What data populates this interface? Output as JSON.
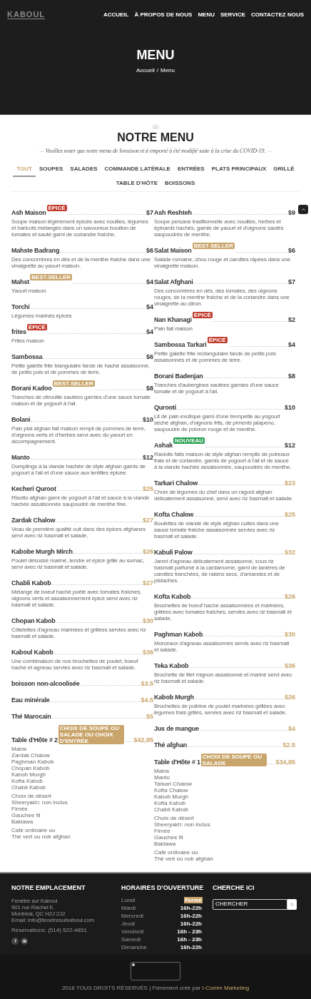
{
  "header": {
    "logo": "KABOUL",
    "nav": [
      {
        "label": "ACCUEIL",
        "selected": false
      },
      {
        "label": "À PROPOS DE NOUS",
        "selected": false
      },
      {
        "label": "MENU",
        "selected": false
      },
      {
        "label": "SERVICE",
        "selected": false
      },
      {
        "label": "CONTACTEZ NOUS",
        "selected": false
      }
    ],
    "title": "MENU",
    "breadcrumb": [
      "Accueil",
      "/",
      "Menu"
    ]
  },
  "menu": {
    "title": "NOTRE MENU",
    "notice": "Veuillez noter que notre menu de livraison et à emporté à été modifié suite à la crise du COVID-19.",
    "tabs": [
      {
        "label": "TOUT",
        "selected": true
      },
      {
        "label": "SOUPES",
        "selected": false
      },
      {
        "label": "SALADES",
        "selected": false
      },
      {
        "label": "COMMANDE LATÉRALE",
        "selected": false
      },
      {
        "label": "ENTRÉES",
        "selected": false
      },
      {
        "label": "PLATS PRINCIPAUX",
        "selected": false
      },
      {
        "label": "GRILLÉ",
        "selected": false
      },
      {
        "label": "TABLE D'HÔTE",
        "selected": false
      },
      {
        "label": "BOISSONS",
        "selected": false
      }
    ],
    "columns": [
      [
        {
          "name": "Ash Maison",
          "badge": {
            "kind": "spicy",
            "label": "ÉPICÉ"
          },
          "price": "$7",
          "color": "#333333",
          "description": "Soupe maison légèrement épicée avec nouilles, légumes et haricots mélangés dans un savoureux bouillon de tomates et sauté garni de coriandre fraîche."
        },
        {
          "name": "Mahste Badrang",
          "price": "$6",
          "color": "#333333",
          "description": "Des concombres en dés et de la menthe fraîche dans une vinaigrette au yaourt maison."
        },
        {
          "name": "Mahst",
          "badge": {
            "kind": "bestseller",
            "label": "BEST-SELLER"
          },
          "price": "$4",
          "color": "#333333",
          "description": "Yaourt maison"
        },
        {
          "name": "Torchi",
          "price": "$4",
          "color": "#333333",
          "description": "Légumes marinés épicés"
        },
        {
          "name": "frites",
          "badge": {
            "kind": "spicy",
            "label": "ÉPICÉ"
          },
          "price": "$4",
          "color": "#333333",
          "description": "Frites maison"
        },
        {
          "name": "Sambossa",
          "price": "$6",
          "color": "#333333",
          "description": "Petite galette frite triangulaire farcie de haché assaisonné, de petits pois et de pommes de terre."
        },
        {
          "name": "Borani Kadoo",
          "badge": {
            "kind": "bestseller",
            "label": "BEST-SELLER"
          },
          "price": "$8",
          "color": "#333333",
          "description": "Tranches de citrouille sautées garnies d'une sauce tomate maison et de yogourt à l'ail."
        },
        {
          "name": "Bolani",
          "price": "$10",
          "color": "#333333",
          "description": "Pain plat afghan fait maison rempli de pommes de terre, d'oignons verts et d'herbes servi avec du yaourt en accompagnement."
        },
        {
          "name": "Manto",
          "price": "$12",
          "color": "#333333",
          "description": "Dumplings à la viande hachée de style afghan garnis de yogourt à l'ail et d'une sauce aux lentilles épicée."
        },
        {
          "name": "Kecheri Quroot",
          "price": "$25",
          "color": "#c9a56b",
          "description": "Risotto afghan garni de yogourt à l'ail et sauce à la viande hachée assaisonnée saupoudré de menthe fine."
        },
        {
          "name": "Zardak Chalow",
          "price": "$27",
          "color": "#c9a56b",
          "description": "Veau de première qualité cuit dans des épices afghanes servi avec riz basmati et salade."
        },
        {
          "name": "Kabobe Murgh Mirch",
          "price": "$26",
          "color": "#c9a56b",
          "description": "Poulet désossé mariné, tendre et épicé grillé au sumac, servi avec riz basmati et salade."
        },
        {
          "name": "Chabli Kabob",
          "price": "$27",
          "color": "#c9a56b",
          "description": "Mélange de boeuf haché poêlé avec tomates fraîches, oignons verts et assaisonnement épicé servi avec riz basmati et salade."
        },
        {
          "name": "Chopan Kabob",
          "price": "$30",
          "color": "#c9a56b",
          "description": "Côtelettes d'agneau marinées et grillées servies avec riz basmati et salade."
        },
        {
          "name": "Kaboul Kabob",
          "price": "$36",
          "color": "#c9a56b",
          "description": "Une combinaison de nos brochettes de poulet, boeuf haché et agneau servies avec riz basmati et salade."
        },
        {
          "name": "boisson non-alcoolisée",
          "price": "$3.5",
          "color": "#c9a56b"
        },
        {
          "name": "Eau minérale",
          "price": "$4.5",
          "color": "#c9a56b"
        },
        {
          "name": "Thé Marocain",
          "price": "$5",
          "color": "#c9a56b"
        },
        {
          "name": "Table d'Hôte # 2",
          "badge": {
            "kind": "info",
            "label": "CHOIX DE SOUPE OU SALADE OU CHOIX D'ENTRÉE"
          },
          "price": "$42,95",
          "color": "#c9a56b",
          "courses": [
            [
              "Mains",
              "Zardak Chalow",
              "Paghman Kabob",
              "Chopan Kabob",
              "Kabob Murgh",
              "Kofta Kabob",
              "Chabli Kabob"
            ],
            [
              "Choix de désert",
              "Sheeryakh: non inclus",
              "Firnée",
              "Gauchee fil",
              "Baklawa"
            ],
            [
              "Café ordinaire ou",
              "Thé vert ou noir afghan"
            ]
          ]
        }
      ],
      [
        {
          "name": "Ash Reshteh",
          "price": "$9",
          "color": "#333333",
          "description": "Soupe persane traditionnelle avec nouilles, herbes et épinards hachés, garnie de yaourt et d'oignons sautés saupoudrés de menthe."
        },
        {
          "name": "Salat Maison",
          "badge": {
            "kind": "bestseller",
            "label": "BEST-SELLER"
          },
          "price": "$6",
          "color": "#333333",
          "description": "Salade romaine, chou rouge et carottes râpées dans une vinaigrette maison."
        },
        {
          "name": "Salat Afghani",
          "price": "$7",
          "color": "#333333",
          "description": "Des concombres en dés, des tomates, des oignons rouges, de la menthe fraîche et de la coriandre dans une vinaigrette au citron."
        },
        {
          "name": "Nan Khanagi",
          "badge": {
            "kind": "spicy",
            "label": "ÉPICÉ"
          },
          "price": "$2",
          "color": "#333333",
          "description": "Pain fait maison"
        },
        {
          "name": "Sambossa Tarkari",
          "badge": {
            "kind": "spicy",
            "label": "ÉPICÉ"
          },
          "price": "$4",
          "color": "#333333",
          "description": "Petite galette frite rectangulaire farcie de petits pois assaisonnés et de pommes de terre."
        },
        {
          "name": "Borani Badenjan",
          "price": "$8",
          "color": "#333333",
          "description": "Tranches d'aubergines sautées garnies d'une sauce tomate et de yogourt à l'ail."
        },
        {
          "name": "Qurooti",
          "price": "$10",
          "color": "#333333",
          "description": "Lit de pain exotique garni d'une trempette au yogourt séché afghan, d'oignons frits, de piments jalapeno, saupoudré de poivron rouge et de menthe."
        },
        {
          "name": "Ashak",
          "badge": {
            "kind": "new",
            "label": "NOUVEAU"
          },
          "price": "$12",
          "color": "#333333",
          "description": "Raviolis faits maison de style afghan remplis de poireaux frais et de coriandre, garnis de yogourt à l'ail et de sauce à la viande hachée assaisonnée, saupoudrés de menthe."
        },
        {
          "name": "Tarkari Chalow",
          "price": "$23",
          "color": "#c9a56b",
          "description": "Choix de légumes du chef dans un ragoût afghan délicatement assaisonné, servi avec riz basmati et salade."
        },
        {
          "name": "Kofta Chalow",
          "price": "$25",
          "color": "#c9a56b",
          "description": "Boulettes de viande de style afghan cuites dans une sauce tomate fraîche assaisonnée servies avec riz basmati et salade."
        },
        {
          "name": "Kabuli Palow",
          "price": "$32",
          "color": "#c9a56b",
          "description": "Jarret d'agneau délicatement assaisonné, sous riz basmati parfumé à la cardamome, garni de lanières de carottes tranchées, de raisins secs, d'amandes et de pistaches."
        },
        {
          "name": "Kofta Kabob",
          "price": "$26",
          "color": "#c9a56b",
          "description": "Brochettes de boeuf haché assaisonnées et marinées, grillées avec tomates fraîches, servies avec riz basmati et salade."
        },
        {
          "name": "Paghman Kabob",
          "price": "$30",
          "color": "#c9a56b",
          "description": "Morceaux d'agneau assaisonnés servis avec riz basmati et salade."
        },
        {
          "name": "Teka Kabob",
          "price": "$36",
          "color": "#c9a56b",
          "description": "Brochette de filet mignon assaisonné et mariné servi avec riz basmati et salade."
        },
        {
          "name": "Kabob Murgh",
          "price": "$26",
          "color": "#c9a56b",
          "description": "Brochettes de poitrine de poulet marinées grillées avec légumes frais grillés, servies avec riz basmati et salade."
        },
        {
          "name": "Jus de mangue",
          "price": "$4",
          "color": "#c9a56b"
        },
        {
          "name": "Thé afghan",
          "price": "$2.5",
          "color": "#c9a56b"
        },
        {
          "name": "Table d'Hôte # 1",
          "badge": {
            "kind": "info",
            "label": "CHOIX DE SOUPE OU SALADE"
          },
          "price": "$34,95",
          "color": "#c9a56b",
          "courses": [
            [
              "Mains",
              "Manto",
              "Tarkari Chalow",
              "Kofta Chalow",
              "Kabob Murgh",
              "Kofta Kabob",
              "Chabli Kabob"
            ],
            [
              "Choix de désert",
              "Sheeryakh: non inclus",
              "Firnée",
              "Gauchee fil",
              "Baklawa"
            ],
            [
              "Café ordinaire ou",
              "Thé vert ou noir afghan"
            ]
          ]
        }
      ]
    ]
  },
  "footer": {
    "location": {
      "title": "NOTRE EMPLACEMENT",
      "address": [
        "Fenêtre sur Kaboul",
        "901 rue Rachel E.",
        "Montréal, QC H2J 2J2",
        "Email: info@fenetresurkaboul.com"
      ],
      "phone": "Réservations: (514) 522-4851"
    },
    "hours": {
      "title": "HORAIRES D'OUVERTURE",
      "days": [
        {
          "day": "Lundi",
          "hours": "Fermé",
          "closed": true
        },
        {
          "day": "Mardi",
          "hours": "16h-22h",
          "closed": false
        },
        {
          "day": "Mercredi",
          "hours": "16h-22h",
          "closed": false
        },
        {
          "day": "Jeudi",
          "hours": "16h-22h",
          "closed": false
        },
        {
          "day": "Vendredi",
          "hours": "16h - 23h",
          "closed": false
        },
        {
          "day": "Samedi",
          "hours": "16h - 23h",
          "closed": false
        },
        {
          "day": "Dimanche",
          "hours": "16h-22h",
          "closed": false
        }
      ]
    },
    "search": {
      "title": "CHERCHE ICI",
      "placeholder": "CHERCHER"
    },
    "copyright": "2018 TOUS DROITS RÉSERVÉS | Fièrement créé par",
    "credit_link": "I-Comm Marketing"
  }
}
